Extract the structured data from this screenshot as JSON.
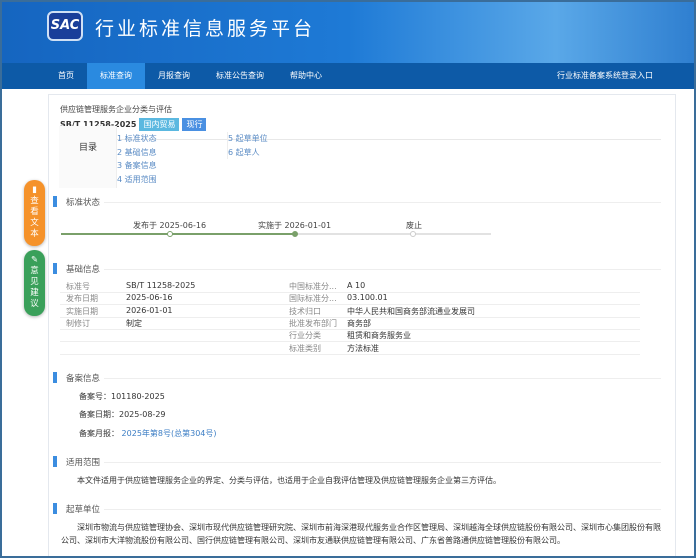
{
  "header": {
    "logo": "SAC",
    "title": "行业标准信息服务平台"
  },
  "nav": {
    "items": [
      "首页",
      "标准查询",
      "月报查询",
      "标准公告查询",
      "帮助中心"
    ],
    "right": "行业标准备案系统登录入口"
  },
  "standard": {
    "title": "供应链管理服务企业分类与评估",
    "code": "SB/T 11258-2025",
    "tags": [
      "国内贸易",
      "现行"
    ],
    "tag_colors": [
      "#5bb8e0",
      "#4a90e2"
    ]
  },
  "toc": {
    "label": "目录",
    "left": [
      "1 标准状态",
      "2 基础信息",
      "3 备案信息",
      "4 适用范围"
    ],
    "right": [
      "5 起草单位",
      "6 起草人"
    ]
  },
  "status": {
    "heading": "标准状态",
    "published": "发布于 2025-06-16",
    "implemented": "实施于 2026-01-01",
    "abolished": "废止"
  },
  "basic": {
    "heading": "基础信息",
    "left": [
      [
        "标准号",
        "SB/T 11258-2025"
      ],
      [
        "发布日期",
        "2025-06-16"
      ],
      [
        "实施日期",
        "2026-01-01"
      ],
      [
        "制修订",
        "制定"
      ]
    ],
    "right": [
      [
        "中国标准分...",
        "A 10"
      ],
      [
        "国际标准分...",
        "03.100.01"
      ],
      [
        "技术归口",
        "中华人民共和国商务部流通业发展司"
      ],
      [
        "批准发布部门",
        "商务部"
      ],
      [
        "行业分类",
        "租赁和商务服务业"
      ],
      [
        "标准类别",
        "方法标准"
      ]
    ]
  },
  "filing": {
    "heading": "备案信息",
    "no_label": "备案号：",
    "no": "101180-2025",
    "date_label": "备案日期：",
    "date": "2025-08-29",
    "report_label": "备案月报：",
    "report": "2025年第8号(总第304号)"
  },
  "scope": {
    "heading": "适用范围",
    "text": "本文件适用于供应链管理服务企业的界定、分类与评估，也适用于企业自我评估管理及供应链管理服务企业第三方评估。"
  },
  "drafters": {
    "heading": "起草单位",
    "text": "深圳市物流与供应链管理协会、深圳市现代供应链管理研究院、深圳市前海深港现代服务业合作区管理局、深圳越海全球供应链股份有限公司、深圳市心集团股份有限公司、深圳市大洋物流股份有限公司、国行供应链管理有限公司、深圳市友通联供应链管理有限公司、广东省普路通供应链管理股份有限公司。"
  },
  "float": {
    "view_text": "查看文本",
    "feedback": "意见建议"
  }
}
